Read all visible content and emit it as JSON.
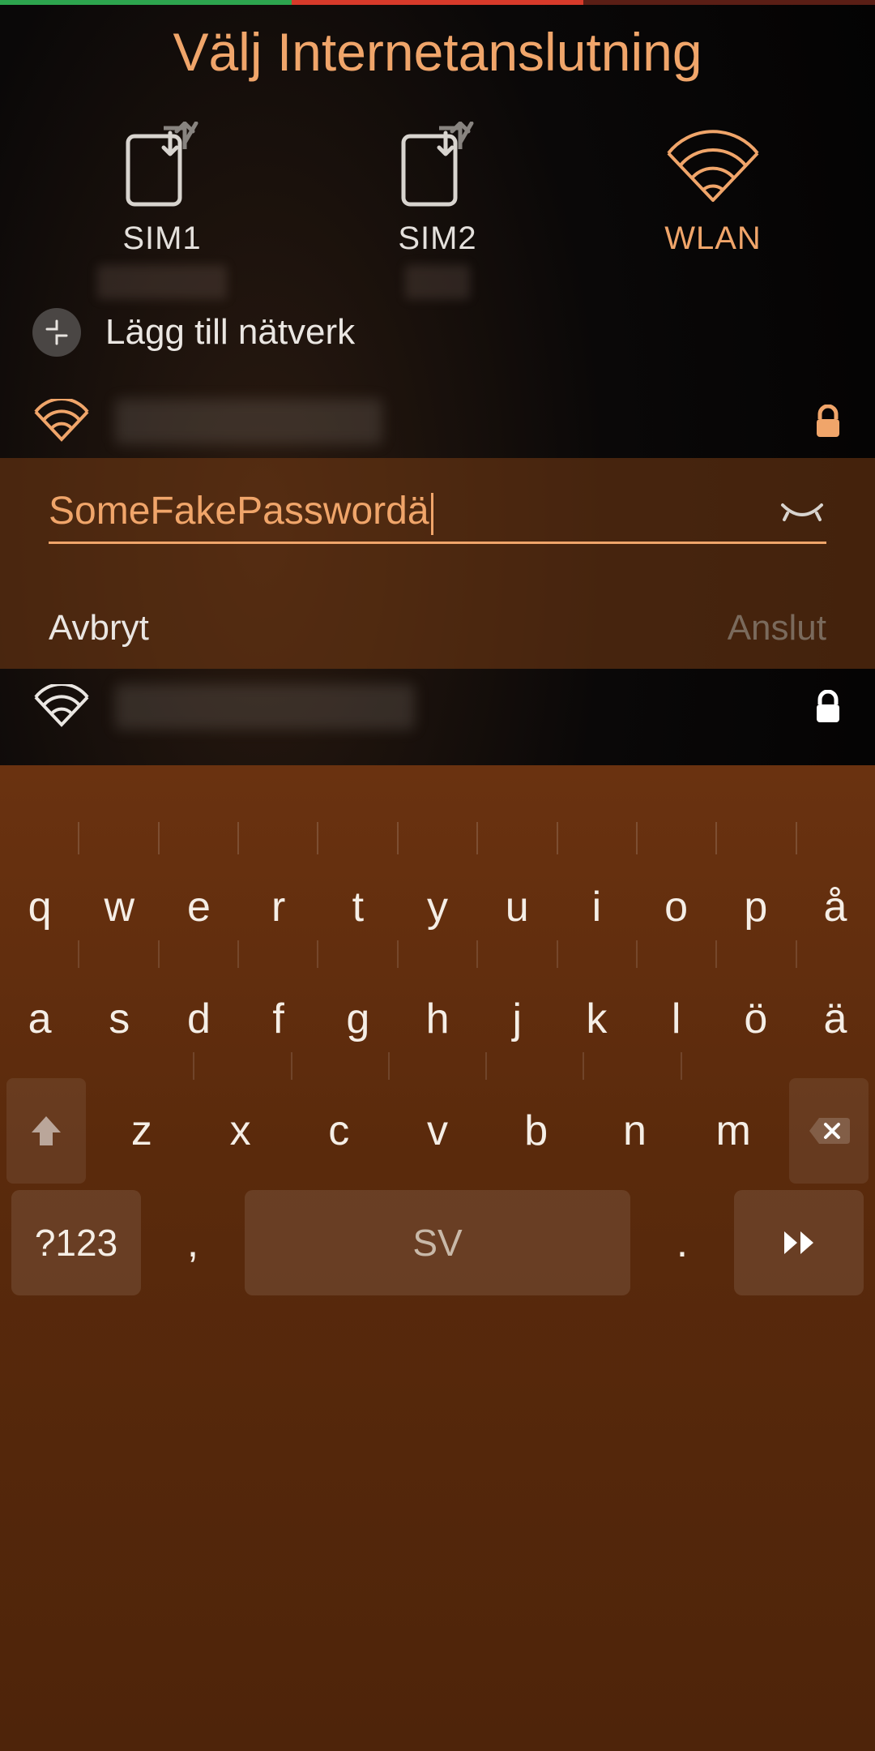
{
  "colors": {
    "accent": "#f0a56a"
  },
  "title": "Välj Internetanslutning",
  "connections": [
    {
      "id": "sim1",
      "label": "SIM1",
      "active": false
    },
    {
      "id": "sim2",
      "label": "SIM2",
      "active": false
    },
    {
      "id": "wlan",
      "label": "WLAN",
      "active": true
    }
  ],
  "add_network_label": "Lägg till nätverk",
  "selected_network": {
    "secured": true
  },
  "password": {
    "value": "SomeFakePasswordä",
    "visible": false,
    "cancel_label": "Avbryt",
    "connect_label": "Anslut",
    "connect_enabled": false
  },
  "other_network": {
    "secured": true
  },
  "keyboard": {
    "layout_label": "SV",
    "symbols_label": "?123",
    "rows": {
      "r1": [
        "q",
        "w",
        "e",
        "r",
        "t",
        "y",
        "u",
        "i",
        "o",
        "p",
        "å"
      ],
      "r2": [
        "a",
        "s",
        "d",
        "f",
        "g",
        "h",
        "j",
        "k",
        "l",
        "ö",
        "ä"
      ],
      "r3": [
        "z",
        "x",
        "c",
        "v",
        "b",
        "n",
        "m"
      ]
    },
    "comma": ",",
    "period": "."
  }
}
